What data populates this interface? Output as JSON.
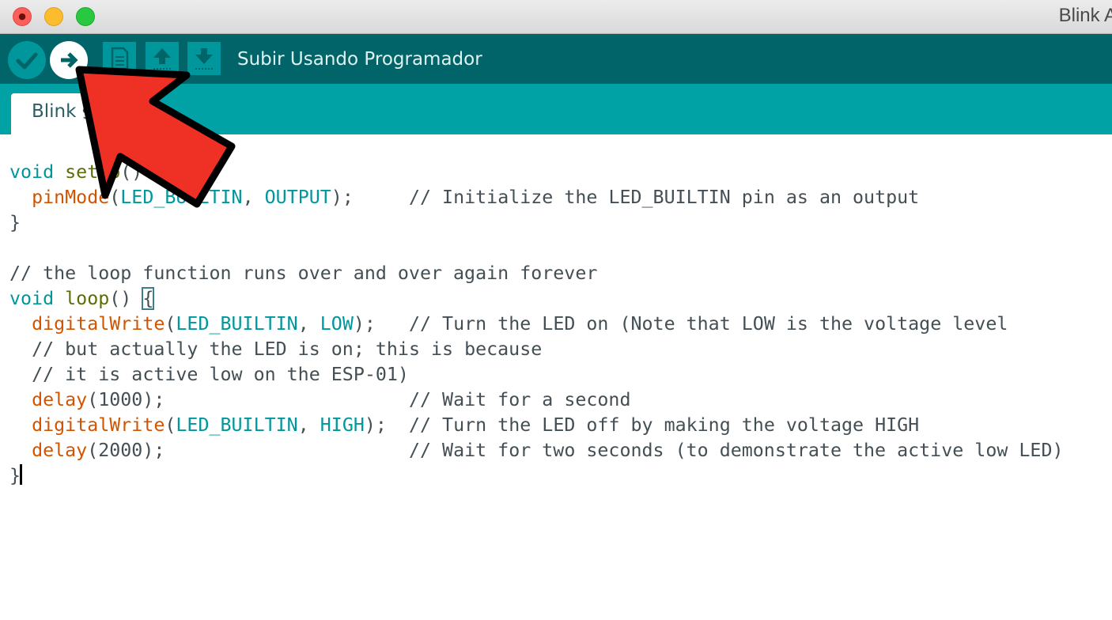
{
  "window": {
    "title": "Blink A",
    "traffic_lights": [
      "close",
      "minimize",
      "maximize"
    ]
  },
  "toolbar": {
    "verify_icon": "checkmark-icon",
    "upload_icon": "arrow-right-icon",
    "new_icon": "new-file-icon",
    "open_icon": "arrow-up-icon",
    "save_icon": "arrow-down-icon",
    "status_text": "Subir Usando Programador"
  },
  "tabs": [
    {
      "label": "Blink",
      "modified_marker": "§"
    }
  ],
  "editor": {
    "lines": [
      "void setup() {",
      "  pinMode(LED_BUILTIN, OUTPUT);     // Initialize the LED_BUILTIN pin as an output",
      "}",
      "",
      "// the loop function runs over and over again forever",
      "void loop() {",
      "  digitalWrite(LED_BUILTIN, LOW);   // Turn the LED on (Note that LOW is the voltage level",
      "  // but actually the LED is on; this is because",
      "  // it is active low on the ESP-01)",
      "  delay(1000);                      // Wait for a second",
      "  digitalWrite(LED_BUILTIN, HIGH);  // Turn the LED off by making the voltage HIGH",
      "  delay(2000);                      // Wait for two seconds (to demonstrate the active low LED)",
      "}"
    ]
  },
  "annotation": {
    "type": "arrow",
    "color": "#ee3124",
    "points_to": "upload-button"
  },
  "colors": {
    "toolbar_bg": "#006468",
    "tabstrip_bg": "#00a2a6",
    "keyword": "#00979c",
    "function": "#d35400",
    "comment": "#434f54"
  }
}
